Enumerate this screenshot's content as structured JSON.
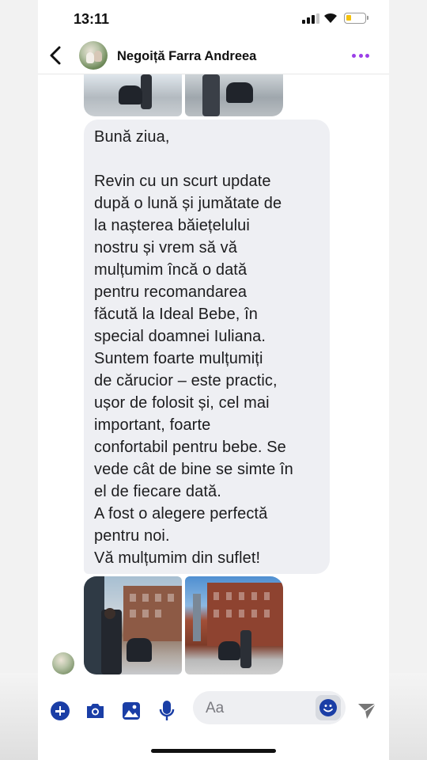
{
  "status_bar": {
    "time": "13:11"
  },
  "header": {
    "contact_name": "Negoiță Farra Andreea"
  },
  "message": {
    "lines": [
      "Bună ziua,",
      "",
      "Revin cu un scurt update",
      "după o lună și jumătate de",
      "la nașterea băiețelului",
      "nostru și vrem să vă",
      "mulțumim încă o dată",
      "pentru recomandarea",
      "făcută la Ideal Bebe, în",
      "special doamnei Iuliana.",
      "Suntem foarte mulțumiți",
      "de cărucior – este practic,",
      "ușor de folosit și, cel mai",
      "important, foarte",
      "confortabil pentru bebe. Se",
      "vede cât de bine se simte în",
      "el de fiecare dată.",
      "A fost o alegere perfectă",
      "pentru noi.",
      "Vă mulțumim din suflet!"
    ]
  },
  "composer": {
    "placeholder": "Aa",
    "icons": [
      "plus-icon",
      "camera-icon",
      "gallery-icon",
      "microphone-icon",
      "emoji-icon",
      "send-icon"
    ]
  },
  "colors": {
    "accent": "#1a3ea6",
    "more_menu": "#9b3fe8",
    "bubble": "#eeeff3"
  }
}
